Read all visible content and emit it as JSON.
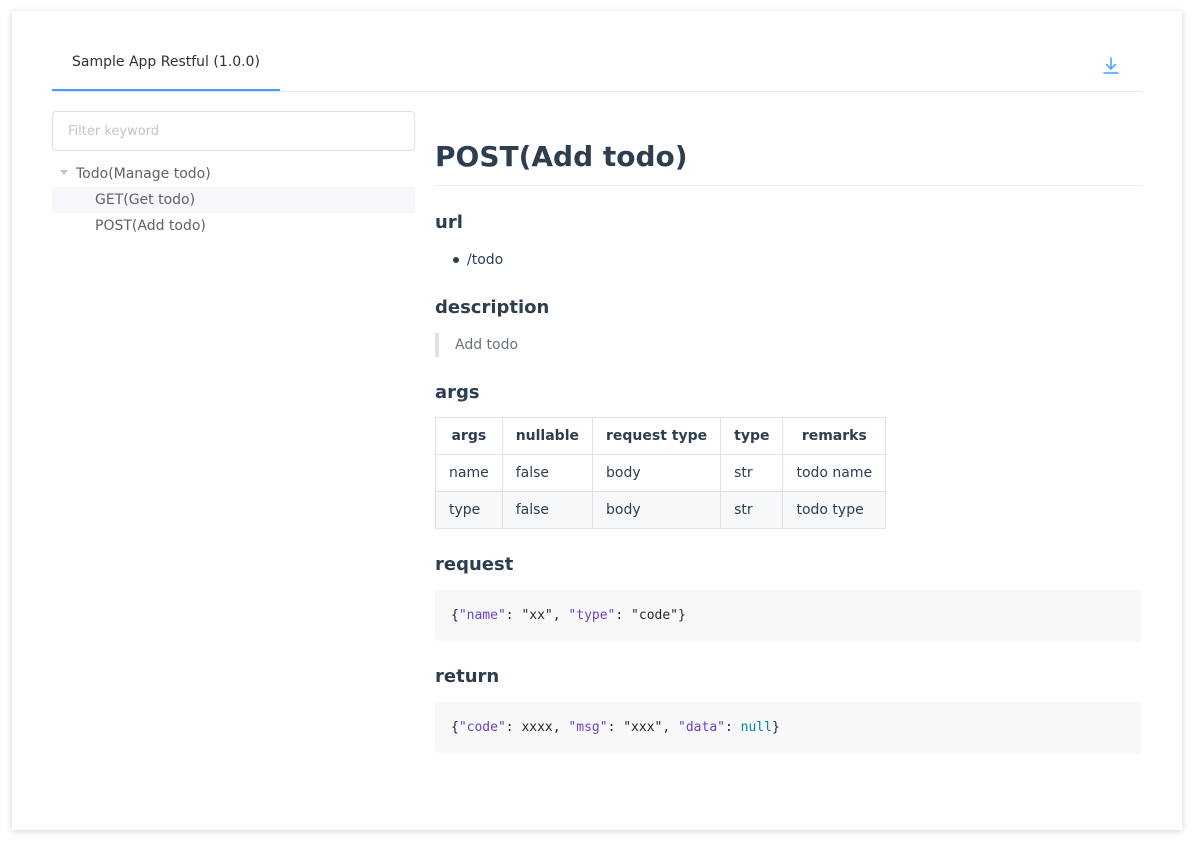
{
  "tabs": [
    {
      "label": "Sample App Restful (1.0.0)",
      "active": true
    }
  ],
  "sidebar": {
    "filter_placeholder": "Filter keyword",
    "tree": {
      "root": "Todo(Manage todo)",
      "children": [
        {
          "label": "GET(Get todo)",
          "current": true
        },
        {
          "label": "POST(Add todo)",
          "current": false
        }
      ]
    }
  },
  "main": {
    "title": "POST(Add todo)",
    "url": {
      "heading": "url",
      "items": [
        "/todo"
      ]
    },
    "description": {
      "heading": "description",
      "text": "Add todo"
    },
    "args": {
      "heading": "args",
      "columns": [
        "args",
        "nullable",
        "request type",
        "type",
        "remarks"
      ],
      "rows": [
        [
          "name",
          "false",
          "body",
          "str",
          "todo name"
        ],
        [
          "type",
          "false",
          "body",
          "str",
          "todo type"
        ]
      ]
    },
    "request": {
      "heading": "request",
      "code": {
        "open": "{",
        "k1": "\"name\"",
        "sep1": ": ",
        "v1": "\"xx\"",
        "comma1": ", ",
        "k2": "\"type\"",
        "sep2": ": ",
        "v2": "\"code\"",
        "close": "}"
      }
    },
    "return": {
      "heading": "return",
      "code": {
        "open": "{",
        "k1": "\"code\"",
        "sep1": ": ",
        "v1": "xxxx",
        "comma1": ", ",
        "k2": "\"msg\"",
        "sep2": ": ",
        "v2": "\"xxx\"",
        "comma2": ", ",
        "k3": "\"data\"",
        "sep3": ": ",
        "v3": "null",
        "close": "}"
      }
    }
  },
  "colors": {
    "accent": "#409eff",
    "code_key": "#6f42c1",
    "code_null": "#0086b3"
  }
}
